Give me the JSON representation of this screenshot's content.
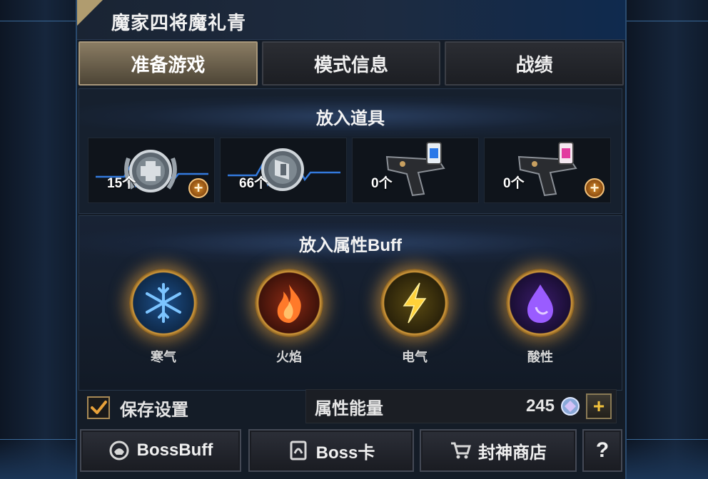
{
  "title": "魔家四将魔礼青",
  "tabs": [
    {
      "label": "准备游戏",
      "active": true
    },
    {
      "label": "模式信息",
      "active": false
    },
    {
      "label": "战绩",
      "active": false
    }
  ],
  "items_section": {
    "heading": "放入道具",
    "items": [
      {
        "icon": "medkit-icon",
        "count": "15个",
        "has_add": true
      },
      {
        "icon": "armor-icon",
        "count": "66个",
        "has_add": false
      },
      {
        "icon": "blue-injector-gun-icon",
        "count": "0个",
        "has_add": false
      },
      {
        "icon": "pink-injector-gun-icon",
        "count": "0个",
        "has_add": true
      }
    ]
  },
  "buff_section": {
    "heading": "放入属性Buff",
    "buffs": [
      {
        "label": "寒气",
        "icon": "snowflake-icon",
        "color": "#2f8fe0"
      },
      {
        "label": "火焰",
        "icon": "flame-icon",
        "color": "#e0502a"
      },
      {
        "label": "电气",
        "icon": "lightning-icon",
        "color": "#e8c02a"
      },
      {
        "label": "酸性",
        "icon": "acid-drop-icon",
        "color": "#9a4ae8"
      }
    ]
  },
  "save_settings": {
    "label": "保存设置",
    "checked": true
  },
  "energy": {
    "label": "属性能量",
    "value": "245"
  },
  "bottom_buttons": [
    {
      "label": "BossBuff",
      "icon": "boss-helmet-icon"
    },
    {
      "label": "Boss卡",
      "icon": "boss-card-icon"
    },
    {
      "label": "封神商店",
      "icon": "cart-icon"
    },
    {
      "label": "?",
      "icon": ""
    }
  ]
}
